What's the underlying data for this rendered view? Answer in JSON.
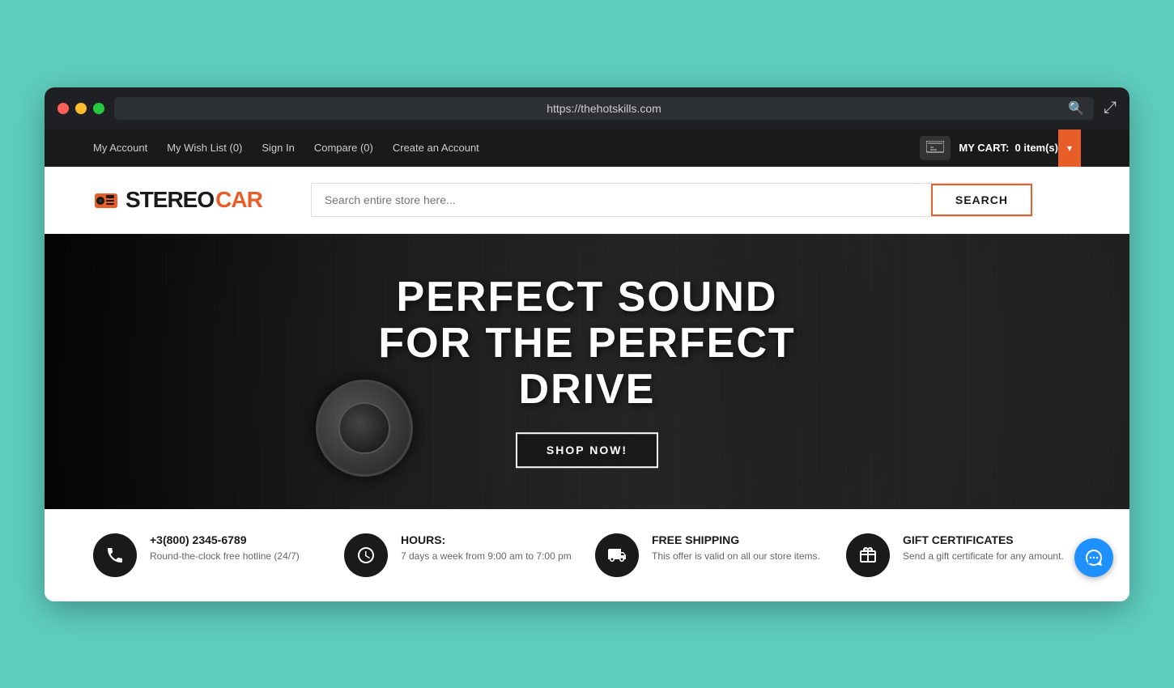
{
  "browser": {
    "url": "https://thehotskills.com",
    "search_icon": "🔍",
    "expand_icon": "⤢"
  },
  "topnav": {
    "links": [
      {
        "label": "My Account",
        "id": "my-account"
      },
      {
        "label": "My Wish List (0)",
        "id": "wishlist"
      },
      {
        "label": "Sign In",
        "id": "signin"
      },
      {
        "label": "Compare (0)",
        "id": "compare"
      },
      {
        "label": "Create an Account",
        "id": "create-account"
      }
    ],
    "cart_label": "MY CART:",
    "cart_count": "0 item(s)"
  },
  "logo": {
    "stereo": "STEREO",
    "car": "CAR"
  },
  "search": {
    "placeholder": "Search entire store here...",
    "button_label": "SEARCH"
  },
  "hero": {
    "line1": "PERFECT SOUND",
    "line2": "FOR THE PERFECT DRIVE",
    "cta": "SHOP NOW!"
  },
  "features": [
    {
      "icon": "📞",
      "title": "+3(800) 2345-6789",
      "description": "Round-the-clock free hotline (24/7)"
    },
    {
      "icon": "🕐",
      "title": "HOURS:",
      "description": "7 days a week from 9:00 am to 7:00 pm"
    },
    {
      "icon": "🚚",
      "title": "FREE SHIPPING",
      "description": "This offer is valid on all our store items."
    },
    {
      "icon": "🎁",
      "title": "GIFT CERTIFICATES",
      "description": "Send a gift certificate for any amount."
    }
  ]
}
